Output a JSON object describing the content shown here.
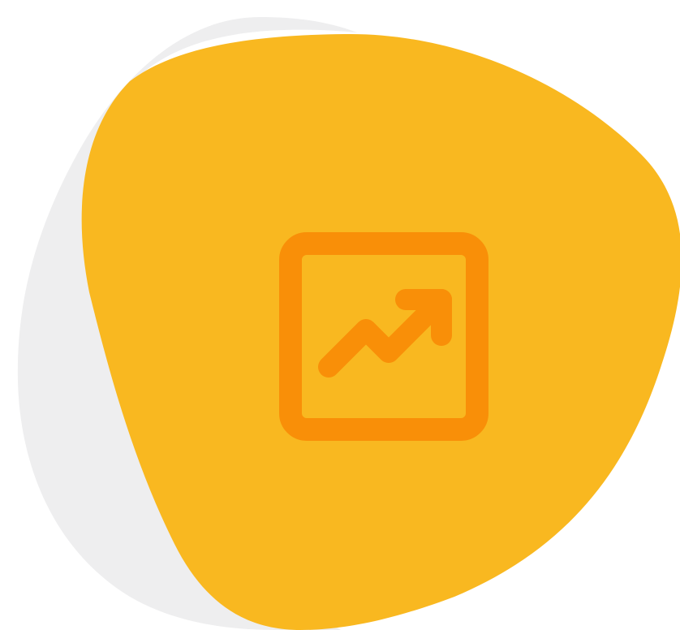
{
  "illustration": {
    "icon": "trending-up-chart-icon",
    "colors": {
      "background": "#ffffff",
      "shadow_blob": "#eeeeef",
      "main_blob": "#f9b820",
      "icon_stroke": "#f98f08"
    }
  }
}
